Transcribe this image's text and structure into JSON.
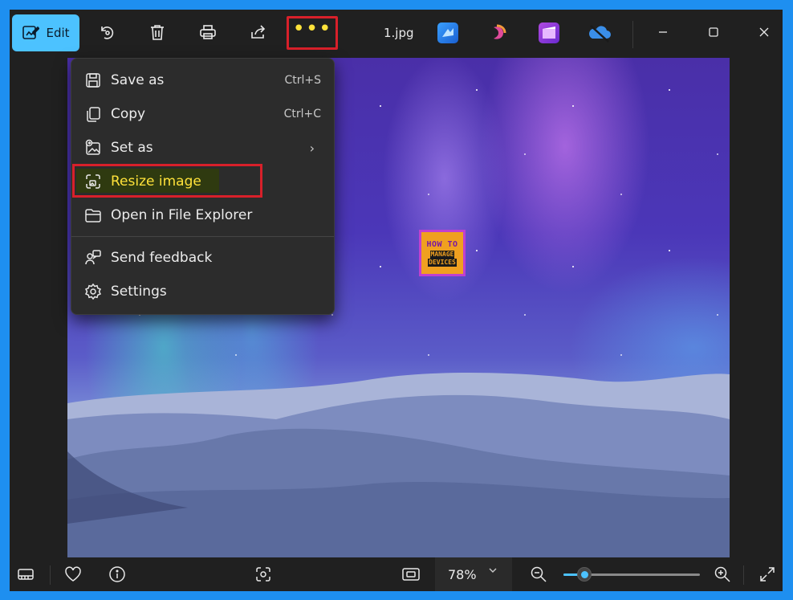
{
  "toolbar": {
    "edit_label": "Edit",
    "filename": "1.jpg",
    "icons": [
      "edit-icon",
      "rotate-icon",
      "delete-icon",
      "print-icon",
      "share-icon",
      "more-icon",
      "designer-icon",
      "copilot-icon",
      "clipchamp-icon",
      "onedrive-icon"
    ],
    "window_controls": [
      "minimize-icon",
      "maximize-icon",
      "close-icon"
    ]
  },
  "menu": {
    "items": [
      {
        "label": "Save as",
        "shortcut": "Ctrl+S",
        "icon": "save-icon"
      },
      {
        "label": "Copy",
        "shortcut": "Ctrl+C",
        "icon": "copy-icon"
      },
      {
        "label": "Set as",
        "icon": "set-as-icon"
      },
      {
        "label": "Resize image",
        "icon": "resize-icon"
      },
      {
        "label": "Open in File Explorer",
        "icon": "folder-icon"
      },
      {
        "label": "Send feedback",
        "icon": "feedback-icon"
      },
      {
        "label": "Settings",
        "icon": "settings-icon"
      }
    ],
    "highlighted": "Resize image"
  },
  "logo": {
    "line1": "HOW TO",
    "line2": "MANAGE",
    "line3": "DEVICES"
  },
  "bottombar": {
    "zoom_value": "78%",
    "zoom_level": 0.15,
    "icons": [
      "filmstrip-icon",
      "favorite-icon",
      "info-icon",
      "face-scan-icon",
      "fit-to-window-icon",
      "zoom-out-icon",
      "zoom-in-icon",
      "fullscreen-icon"
    ]
  },
  "colors": {
    "accent": "#4cc2ff",
    "highlight_border": "#d8202a",
    "highlight_text": "#ffe23a",
    "window_frame": "#1e8ff0"
  }
}
